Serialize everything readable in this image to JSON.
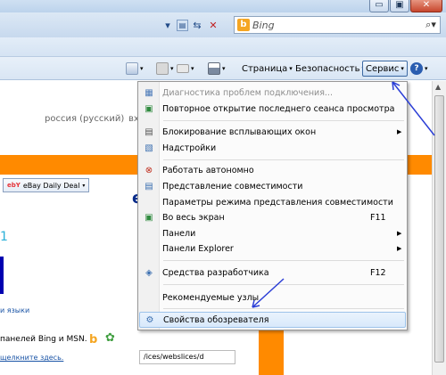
{
  "window": {
    "minimize": "▭",
    "maximize": "▣",
    "close": "✕"
  },
  "addressbar": {
    "search_placeholder": "Bing",
    "search_icon": "search-icon"
  },
  "commandbar": {
    "page_label": "Страница",
    "safety_label": "Безопасность",
    "tools_label": "Сервис",
    "help_label": "?"
  },
  "page": {
    "language": "россия (русский)",
    "lang_cut": "вх",
    "ebay": "eBay Daily Deal",
    "digit": "1",
    "letter_e": "e",
    "languages_link": "и языки",
    "bing_text": "панелей Bing и MSN.",
    "click_here": "щелкните здесь.",
    "url_text": "/ices/webslices/d"
  },
  "menu": {
    "items": [
      {
        "label": "Диагностика проблем подключения...",
        "shortcut": "",
        "submenu": false,
        "disabled": true,
        "icon": "network-diagnose-icon"
      },
      {
        "label": "Повторное открытие последнего сеанса просмотра",
        "shortcut": "",
        "submenu": false,
        "disabled": false,
        "icon": "reopen-session-icon"
      },
      {
        "label": "Блокирование всплывающих окон",
        "shortcut": "",
        "submenu": true,
        "disabled": false,
        "icon": "popup-blocker-icon"
      },
      {
        "label": "Надстройки",
        "shortcut": "",
        "submenu": false,
        "disabled": false,
        "icon": "addons-icon"
      },
      {
        "label": "Работать автономно",
        "shortcut": "",
        "submenu": false,
        "disabled": false,
        "icon": "offline-icon"
      },
      {
        "label": "Представление совместимости",
        "shortcut": "",
        "submenu": false,
        "disabled": false,
        "icon": "compat-view-icon"
      },
      {
        "label": "Параметры режима представления совместимости",
        "shortcut": "",
        "submenu": false,
        "disabled": false,
        "icon": ""
      },
      {
        "label": "Во весь экран",
        "shortcut": "F11",
        "submenu": false,
        "disabled": false,
        "icon": "fullscreen-icon"
      },
      {
        "label": "Панели",
        "shortcut": "",
        "submenu": true,
        "disabled": false,
        "icon": ""
      },
      {
        "label": "Панели Explorer",
        "shortcut": "",
        "submenu": true,
        "disabled": false,
        "icon": ""
      },
      {
        "label": "Средства разработчика",
        "shortcut": "F12",
        "submenu": false,
        "disabled": false,
        "icon": "dev-tools-icon"
      },
      {
        "label": "Рекомендуемые узлы",
        "shortcut": "",
        "submenu": false,
        "disabled": false,
        "icon": ""
      },
      {
        "label": "Свойства обозревателя",
        "shortcut": "",
        "submenu": false,
        "disabled": false,
        "icon": "internet-options-icon"
      }
    ]
  },
  "colors": {
    "accent": "#ff8a00",
    "highlight_border": "#9dc3ea",
    "annotation_arrow": "#2b3ed6"
  }
}
